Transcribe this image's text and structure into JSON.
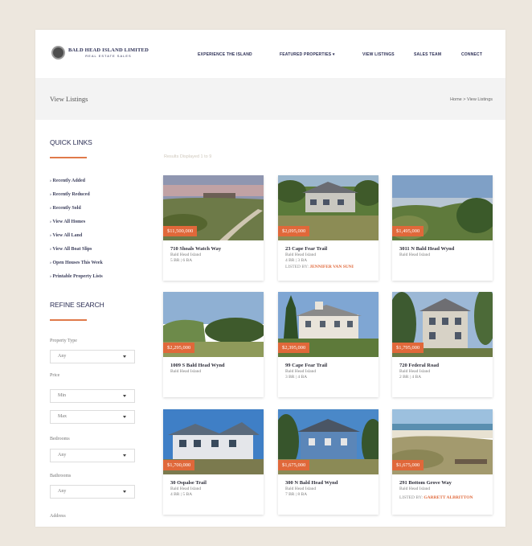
{
  "logo": {
    "title": "BALD HEAD ISLAND LIMITED",
    "subtitle": "REAL ESTATE SALES"
  },
  "nav": [
    {
      "label": "EXPERIENCE THE ISLAND"
    },
    {
      "label": "FEATURED PROPERTIES"
    },
    {
      "label": "VIEW LISTINGS"
    },
    {
      "label": "SALES TEAM"
    },
    {
      "label": "CONNECT"
    }
  ],
  "page": {
    "title": "View Listings",
    "breadcrumb": "Home > View Listings"
  },
  "sidebar": {
    "quick_links_heading": "QUICK LINKS",
    "quick_links": [
      "Recently Added",
      "Recently Reduced",
      "Recently Sold",
      "View All Homes",
      "View All Land",
      "View All Boat Slips",
      "Open Houses This Week",
      "Printable Property Lists"
    ],
    "refine_heading": "REFINE SEARCH",
    "property_type_label": "Property Type",
    "property_type_value": "Any",
    "price_label": "Price",
    "price_min": "Min",
    "price_max": "Max",
    "bedrooms_label": "Bedrooms",
    "bedrooms_value": "Any",
    "bathrooms_label": "Bathrooms",
    "bathrooms_value": "Any",
    "address_label": "Address"
  },
  "results_label": "Results Displayed 1 to 9",
  "listings": [
    {
      "price": "$11,500,000",
      "title": "710 Shoals Watch Way",
      "location": "Bald Head Island",
      "beds": "5 BR | 6 BA",
      "agent_prefix": "",
      "agent_name": ""
    },
    {
      "price": "$2,095,000",
      "title": "23 Cape Fear Trail",
      "location": "Bald Head Island",
      "beds": "4 BR | 3 BA",
      "agent_prefix": "LISTED BY:",
      "agent_name": "JENNIFER VAN SUNI"
    },
    {
      "price": "$1,495,000",
      "title": "3011 N Bald Head Wynd",
      "location": "Bald Head Island",
      "beds": "",
      "agent_prefix": "",
      "agent_name": ""
    },
    {
      "price": "$2,295,000",
      "title": "1009 S Bald Head Wynd",
      "location": "Bald Head Island",
      "beds": "",
      "agent_prefix": "",
      "agent_name": ""
    },
    {
      "price": "$2,395,000",
      "title": "99 Cape Fear Trail",
      "location": "Bald Head Island",
      "beds": "3 BR | 4 BA",
      "agent_prefix": "",
      "agent_name": ""
    },
    {
      "price": "$1,795,000",
      "title": "720 Federal Road",
      "location": "Bald Head Island",
      "beds": "2 BR | 4 BA",
      "agent_prefix": "",
      "agent_name": ""
    },
    {
      "price": "$1,700,000",
      "title": "30 Ospalse Trail",
      "location": "Bald Head Island",
      "beds": "4 BR | 5 BA",
      "agent_prefix": "",
      "agent_name": ""
    },
    {
      "price": "$1,675,000",
      "title": "300 N Bald Head Wynd",
      "location": "Bald Head Island",
      "beds": "7 BR | 8 BA",
      "agent_prefix": "",
      "agent_name": ""
    },
    {
      "price": "$1,675,000",
      "title": "291 Bottom Grove Way",
      "location": "Bald Head Island",
      "beds": "",
      "agent_prefix": "LISTED BY:",
      "agent_name": "GARRETT ALBRITTON"
    }
  ]
}
